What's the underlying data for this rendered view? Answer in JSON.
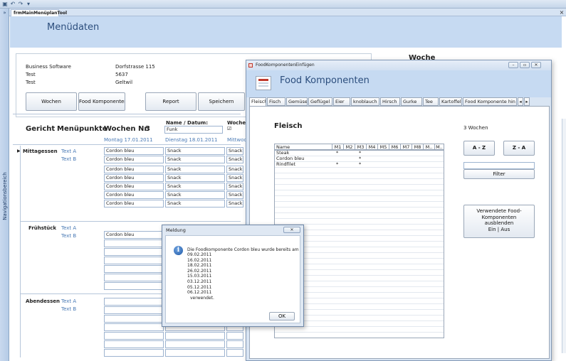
{
  "app": {
    "doc_tab": "frmMainMenüplanTool",
    "close_glyph": "×",
    "nav_toggle": "»",
    "nav_label": "Navigationsbereich",
    "quick_access_icons": [
      "access-icon",
      "undo-icon",
      "redo-icon",
      "customize-icon"
    ]
  },
  "form": {
    "title": "Menüdaten",
    "company": {
      "name": "Business Software",
      "street": "Dorfstrasse 115",
      "contact": "Test",
      "zip": "5637",
      "line3": "Test",
      "city": "Geltwil"
    },
    "buttons": {
      "wochen": "Wochen",
      "food_komponenten": "Food Komponenten",
      "report": "Report",
      "speichern": "Speichern"
    },
    "woche_label": "Woche",
    "headers": {
      "gericht": "Gericht",
      "menuepunkte": "Menüpunkte",
      "wochen_nr_label": "Wochen Nr.",
      "wochen_nr": "3",
      "name_datum": "Name / Datum:",
      "woche_col": "Woche",
      "name_value": "Funk",
      "checkbox": "☑"
    },
    "days": [
      "Montag 17.01.2011",
      "Dienstag 18.01.2011",
      "Mittwoch"
    ],
    "sections": [
      {
        "name": "Mittagessen",
        "items": [
          "Text A",
          "Text B"
        ]
      },
      {
        "name": "Frühstück",
        "items": [
          "Text A",
          "Text B"
        ]
      },
      {
        "name": "Abendessen",
        "items": [
          "Text A",
          "Text B"
        ]
      }
    ],
    "row_marker": "▶",
    "mittag_rows": [
      [
        "Cordon bleu",
        "Snack",
        "Snack"
      ],
      [
        "Cordon bleu",
        "Snack",
        "Snack"
      ],
      [
        "Cordon bleu",
        "Snack",
        "Snack"
      ],
      [
        "Cordon bleu",
        "Snack",
        "Snack"
      ],
      [
        "Cordon bleu",
        "Snack",
        "Snack"
      ],
      [
        "Cordon bleu",
        "Snack",
        "Snack"
      ],
      [
        "Cordon bleu",
        "Snack",
        "Snack"
      ]
    ],
    "fruehstueck_row": "Cordon bleu"
  },
  "food_window": {
    "window_title": "FoodKomponentenEinfügen",
    "title": "Food Komponenten",
    "tabs": [
      "Fleisch",
      "Fisch",
      "Gemüse",
      "Geflügel",
      "Eier",
      "knoblauch",
      "Hirsch",
      "Gurke",
      "Tee",
      "Kartoffel",
      "Food Komponente hin"
    ],
    "tab_arrows": [
      "◂",
      "▸"
    ],
    "section_title": "Fleisch",
    "wochen_count": "3 Wochen",
    "grid_headers": [
      "Name",
      "M1",
      "M2",
      "M3",
      "M4",
      "M5",
      "M6",
      "M7",
      "M8",
      "M..",
      "M.."
    ],
    "grid_rows": [
      {
        "name": "Steak",
        "marks": [
          "*",
          "",
          "*"
        ]
      },
      {
        "name": "Cordon bleu",
        "marks": [
          "",
          "",
          "*"
        ]
      },
      {
        "name": "Rindfilet",
        "marks": [
          "*",
          "",
          "*"
        ]
      }
    ],
    "sort_az": "A - Z",
    "sort_za": "Z - A",
    "filter_label": "Filter",
    "filter_value": "",
    "used_components_button": [
      "Verwendete Food-",
      "Komponenten",
      "ausblenden",
      "Ein | Aus"
    ]
  },
  "message": {
    "title": "Meldung",
    "text": "Die Foodkomponente Cordon bleu wurde bereits am",
    "dates": [
      "09.02.2011",
      "16.02.2011",
      "18.02.2011",
      "26.02.2011",
      "15.03.2011",
      "03.12.2011",
      "05.12.2011",
      "06.12.2011"
    ],
    "suffix": "verwendet.",
    "ok": "OK",
    "info_glyph": "i",
    "close_glyph": "✕"
  },
  "colors": {
    "header_blue": "#c6daf2",
    "title_blue": "#2c4e7d",
    "link_blue": "#4a7ab5"
  }
}
